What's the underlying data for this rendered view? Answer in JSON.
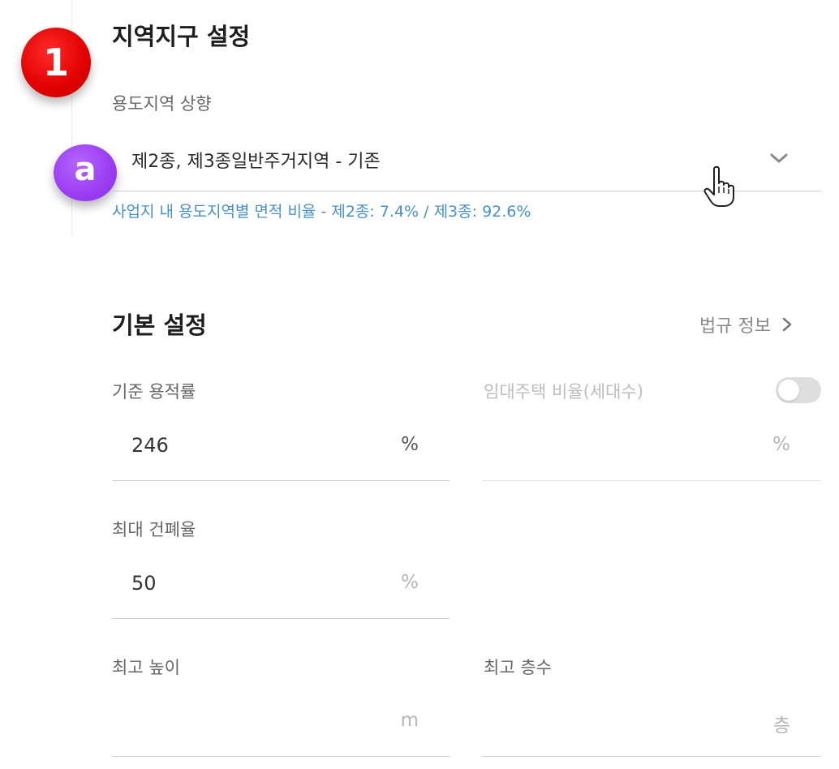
{
  "annotations": {
    "step": "1",
    "sub_step": "a"
  },
  "zoning": {
    "title": "지역지구 설정",
    "upzone_label": "용도지역 상향",
    "selected_option": "제2종, 제3종일반주거지역 - 기존",
    "ratio_note": "사업지 내 용도지역별 면적 비율 - 제2종: 7.4% / 제3종: 92.6%"
  },
  "basic": {
    "title": "기본 설정",
    "law_info_link": "법규 정보",
    "far": {
      "label": "기준 용적률",
      "value": "246",
      "unit": "%"
    },
    "rental": {
      "label": "임대주택 비율(세대수)",
      "value": "",
      "unit": "%",
      "toggle_on": false
    },
    "bcr": {
      "label": "최대 건폐율",
      "value": "50",
      "unit": "%"
    },
    "max_height": {
      "label": "최고 높이",
      "value": "",
      "unit": "m"
    },
    "max_floors": {
      "label": "최고 층수",
      "value": "",
      "unit": "층"
    }
  },
  "colors": {
    "step_badge": "#e00000",
    "sub_badge": "#9a3df2",
    "note_text": "#4a90c8",
    "toggle_off": "#dedede"
  },
  "icons": [
    "chevron-down-icon",
    "chevron-right-icon",
    "hand-cursor-icon"
  ]
}
